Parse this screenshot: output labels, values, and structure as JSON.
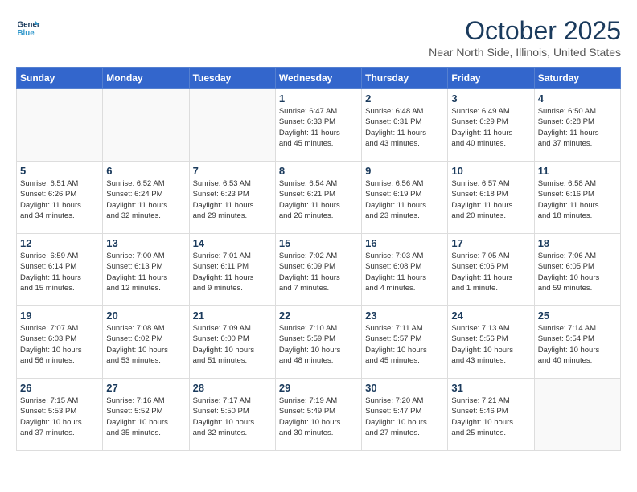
{
  "header": {
    "logo_line1": "General",
    "logo_line2": "Blue",
    "month_year": "October 2025",
    "location": "Near North Side, Illinois, United States"
  },
  "weekdays": [
    "Sunday",
    "Monday",
    "Tuesday",
    "Wednesday",
    "Thursday",
    "Friday",
    "Saturday"
  ],
  "weeks": [
    [
      {
        "day": "",
        "info": ""
      },
      {
        "day": "",
        "info": ""
      },
      {
        "day": "",
        "info": ""
      },
      {
        "day": "1",
        "info": "Sunrise: 6:47 AM\nSunset: 6:33 PM\nDaylight: 11 hours\nand 45 minutes."
      },
      {
        "day": "2",
        "info": "Sunrise: 6:48 AM\nSunset: 6:31 PM\nDaylight: 11 hours\nand 43 minutes."
      },
      {
        "day": "3",
        "info": "Sunrise: 6:49 AM\nSunset: 6:29 PM\nDaylight: 11 hours\nand 40 minutes."
      },
      {
        "day": "4",
        "info": "Sunrise: 6:50 AM\nSunset: 6:28 PM\nDaylight: 11 hours\nand 37 minutes."
      }
    ],
    [
      {
        "day": "5",
        "info": "Sunrise: 6:51 AM\nSunset: 6:26 PM\nDaylight: 11 hours\nand 34 minutes."
      },
      {
        "day": "6",
        "info": "Sunrise: 6:52 AM\nSunset: 6:24 PM\nDaylight: 11 hours\nand 32 minutes."
      },
      {
        "day": "7",
        "info": "Sunrise: 6:53 AM\nSunset: 6:23 PM\nDaylight: 11 hours\nand 29 minutes."
      },
      {
        "day": "8",
        "info": "Sunrise: 6:54 AM\nSunset: 6:21 PM\nDaylight: 11 hours\nand 26 minutes."
      },
      {
        "day": "9",
        "info": "Sunrise: 6:56 AM\nSunset: 6:19 PM\nDaylight: 11 hours\nand 23 minutes."
      },
      {
        "day": "10",
        "info": "Sunrise: 6:57 AM\nSunset: 6:18 PM\nDaylight: 11 hours\nand 20 minutes."
      },
      {
        "day": "11",
        "info": "Sunrise: 6:58 AM\nSunset: 6:16 PM\nDaylight: 11 hours\nand 18 minutes."
      }
    ],
    [
      {
        "day": "12",
        "info": "Sunrise: 6:59 AM\nSunset: 6:14 PM\nDaylight: 11 hours\nand 15 minutes."
      },
      {
        "day": "13",
        "info": "Sunrise: 7:00 AM\nSunset: 6:13 PM\nDaylight: 11 hours\nand 12 minutes."
      },
      {
        "day": "14",
        "info": "Sunrise: 7:01 AM\nSunset: 6:11 PM\nDaylight: 11 hours\nand 9 minutes."
      },
      {
        "day": "15",
        "info": "Sunrise: 7:02 AM\nSunset: 6:09 PM\nDaylight: 11 hours\nand 7 minutes."
      },
      {
        "day": "16",
        "info": "Sunrise: 7:03 AM\nSunset: 6:08 PM\nDaylight: 11 hours\nand 4 minutes."
      },
      {
        "day": "17",
        "info": "Sunrise: 7:05 AM\nSunset: 6:06 PM\nDaylight: 11 hours\nand 1 minute."
      },
      {
        "day": "18",
        "info": "Sunrise: 7:06 AM\nSunset: 6:05 PM\nDaylight: 10 hours\nand 59 minutes."
      }
    ],
    [
      {
        "day": "19",
        "info": "Sunrise: 7:07 AM\nSunset: 6:03 PM\nDaylight: 10 hours\nand 56 minutes."
      },
      {
        "day": "20",
        "info": "Sunrise: 7:08 AM\nSunset: 6:02 PM\nDaylight: 10 hours\nand 53 minutes."
      },
      {
        "day": "21",
        "info": "Sunrise: 7:09 AM\nSunset: 6:00 PM\nDaylight: 10 hours\nand 51 minutes."
      },
      {
        "day": "22",
        "info": "Sunrise: 7:10 AM\nSunset: 5:59 PM\nDaylight: 10 hours\nand 48 minutes."
      },
      {
        "day": "23",
        "info": "Sunrise: 7:11 AM\nSunset: 5:57 PM\nDaylight: 10 hours\nand 45 minutes."
      },
      {
        "day": "24",
        "info": "Sunrise: 7:13 AM\nSunset: 5:56 PM\nDaylight: 10 hours\nand 43 minutes."
      },
      {
        "day": "25",
        "info": "Sunrise: 7:14 AM\nSunset: 5:54 PM\nDaylight: 10 hours\nand 40 minutes."
      }
    ],
    [
      {
        "day": "26",
        "info": "Sunrise: 7:15 AM\nSunset: 5:53 PM\nDaylight: 10 hours\nand 37 minutes."
      },
      {
        "day": "27",
        "info": "Sunrise: 7:16 AM\nSunset: 5:52 PM\nDaylight: 10 hours\nand 35 minutes."
      },
      {
        "day": "28",
        "info": "Sunrise: 7:17 AM\nSunset: 5:50 PM\nDaylight: 10 hours\nand 32 minutes."
      },
      {
        "day": "29",
        "info": "Sunrise: 7:19 AM\nSunset: 5:49 PM\nDaylight: 10 hours\nand 30 minutes."
      },
      {
        "day": "30",
        "info": "Sunrise: 7:20 AM\nSunset: 5:47 PM\nDaylight: 10 hours\nand 27 minutes."
      },
      {
        "day": "31",
        "info": "Sunrise: 7:21 AM\nSunset: 5:46 PM\nDaylight: 10 hours\nand 25 minutes."
      },
      {
        "day": "",
        "info": ""
      }
    ]
  ]
}
